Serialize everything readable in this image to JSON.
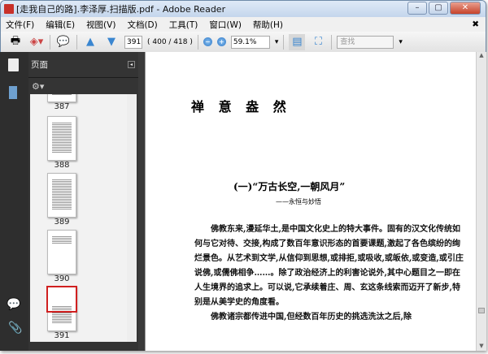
{
  "window": {
    "title": "[走我自己的路].李泽厚.扫描版.pdf - Adobe Reader",
    "minimize": "–",
    "maximize": "▢",
    "close": "✕"
  },
  "menu": [
    "文件(F)",
    "编辑(E)",
    "视图(V)",
    "文档(D)",
    "工具(T)",
    "窗口(W)",
    "帮助(H)"
  ],
  "menu_close": "✖",
  "toolbar": {
    "page_input": "391",
    "page_count": "( 400 / 418 )",
    "zoom": "59.1%",
    "find_placeholder": "查找"
  },
  "panel": {
    "title": "页面",
    "thumbnails": [
      {
        "label": "387"
      },
      {
        "label": "388"
      },
      {
        "label": "389"
      },
      {
        "label": "390"
      },
      {
        "label": "391",
        "selected": true
      }
    ]
  },
  "document": {
    "title": "禅 意 盎 然",
    "heading": "(一)“万古长空,一朝风月”",
    "subheading": "——永恒与妙悟",
    "paragraphs": [
      "佛教东来,漫延华土,是中国文化史上的特大事件。固有的汉文化传统如何与它对待、交接,构成了数百年意识形态的首要课题,激起了各色缤纷的绚烂景色。从艺术到文学,从信仰到思想,或排拒,或吸收,或皈依,或变造,或引庄说佛,或儒佛相争……。除了政治经济上的利害论说外,其中心题目之一即在人生境界的追求上。可以说,它承续着庄、周、玄这条线索而迈开了新步,特别是从美学史的角度看。",
      "佛教诸宗都传进中国,但经数百年历史的挑选洗汰之后,除"
    ]
  }
}
